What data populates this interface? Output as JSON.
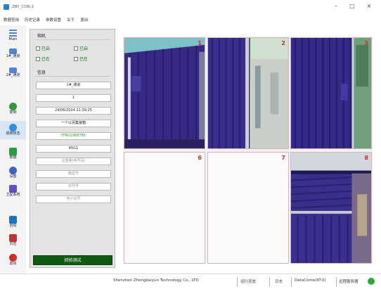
{
  "window": {
    "title": "ZBY_CON-2"
  },
  "menu": [
    "数据查询",
    "历史记录",
    "参数设置",
    "关于",
    "退出"
  ],
  "nav": [
    {
      "label": "Main",
      "icon": "list-icon",
      "color": "#4b86d8"
    },
    {
      "label": "1#_通道",
      "icon": "camera-icon",
      "color": "#4b86d8"
    },
    {
      "label": "2#_通道",
      "icon": "camera-icon",
      "color": "#4b86d8"
    },
    {
      "label": "复制",
      "icon": "copy-icon",
      "color": "#2f9a3a"
    },
    {
      "label": "视频状态",
      "icon": "video-status-icon",
      "color": "#2f8fe0"
    },
    {
      "label": "数据",
      "icon": "data-icon",
      "color": "#23a13a"
    },
    {
      "label": "设置",
      "icon": "settings-icon",
      "color": "#3b62c8"
    },
    {
      "label": "卫星系统",
      "icon": "satellite-icon",
      "color": "#6b4bc4"
    },
    {
      "label": "自动",
      "icon": "auto-icon",
      "color": "#1a73c6"
    },
    {
      "label": "日志",
      "icon": "log-icon",
      "color": "#c23333"
    },
    {
      "label": "退出",
      "icon": "exit-icon",
      "color": "#d52a2a"
    }
  ],
  "panel": {
    "camera_group": "相机",
    "checks": [
      "已启",
      "已启",
      "已在",
      "已在"
    ],
    "info_group": "信息",
    "fields": [
      {
        "text": "1#_通道",
        "style": ""
      },
      {
        "text": "1",
        "style": ""
      },
      {
        "text": "24/06/2024 21:39:25",
        "style": ""
      },
      {
        "text": "一个以另集装箱",
        "style": ""
      },
      {
        "text": "FFAU1968780",
        "style": "green"
      },
      {
        "text": "45G1",
        "style": ""
      },
      {
        "text": "总重量(吨号码)",
        "style": "dim"
      },
      {
        "text": "箱型号",
        "style": "dim"
      },
      {
        "text": "封号号",
        "style": "dim"
      },
      {
        "text": "电子铅号",
        "style": "dim"
      }
    ],
    "main_button": "抓拍测试"
  },
  "cameras": [
    {
      "num": "1",
      "scene": "container"
    },
    {
      "num": "2",
      "scene": "container-gate"
    },
    {
      "num": "3",
      "scene": "container-right"
    },
    {
      "num": "6",
      "scene": "empty"
    },
    {
      "num": "7",
      "scene": "empty"
    },
    {
      "num": "8",
      "scene": "container-top"
    }
  ],
  "status": {
    "company": "Shenzhen Zhongbaiyun Technology Co., LTD",
    "run_state": "运行状态",
    "log": "日志",
    "datacome": "DataCome(KT:0)",
    "remote": "远程服务器"
  }
}
